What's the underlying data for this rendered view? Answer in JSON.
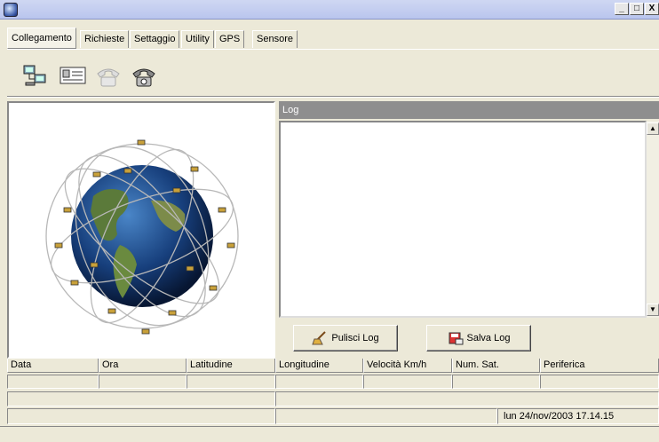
{
  "window": {
    "title": "",
    "buttons": {
      "minimize": "_",
      "maximize": "□",
      "close": "X"
    }
  },
  "tabs": [
    {
      "label": "Collegamento",
      "active": true
    },
    {
      "label": "Richieste"
    },
    {
      "label": "Settaggio"
    },
    {
      "label": "Utility"
    },
    {
      "label": "GPS"
    },
    {
      "label": "Sensore"
    }
  ],
  "toolbar": [
    {
      "icon": "connect-computers-icon"
    },
    {
      "icon": "id-card-icon"
    },
    {
      "icon": "phone-disabled-icon"
    },
    {
      "icon": "phone-icon"
    }
  ],
  "globe": {
    "image": "gps-satellite-constellation-globe"
  },
  "log": {
    "header": "Log",
    "content": "",
    "clear_button": "Pulisci Log",
    "save_button": "Salva Log"
  },
  "grid": {
    "columns": [
      "Data",
      "Ora",
      "Latitudine",
      "Longitudine",
      "Velocità Km/h",
      "Num. Sat.",
      "Periferica"
    ]
  },
  "status": {
    "datetime": "lun 24/nov/2003 17.14.15"
  }
}
